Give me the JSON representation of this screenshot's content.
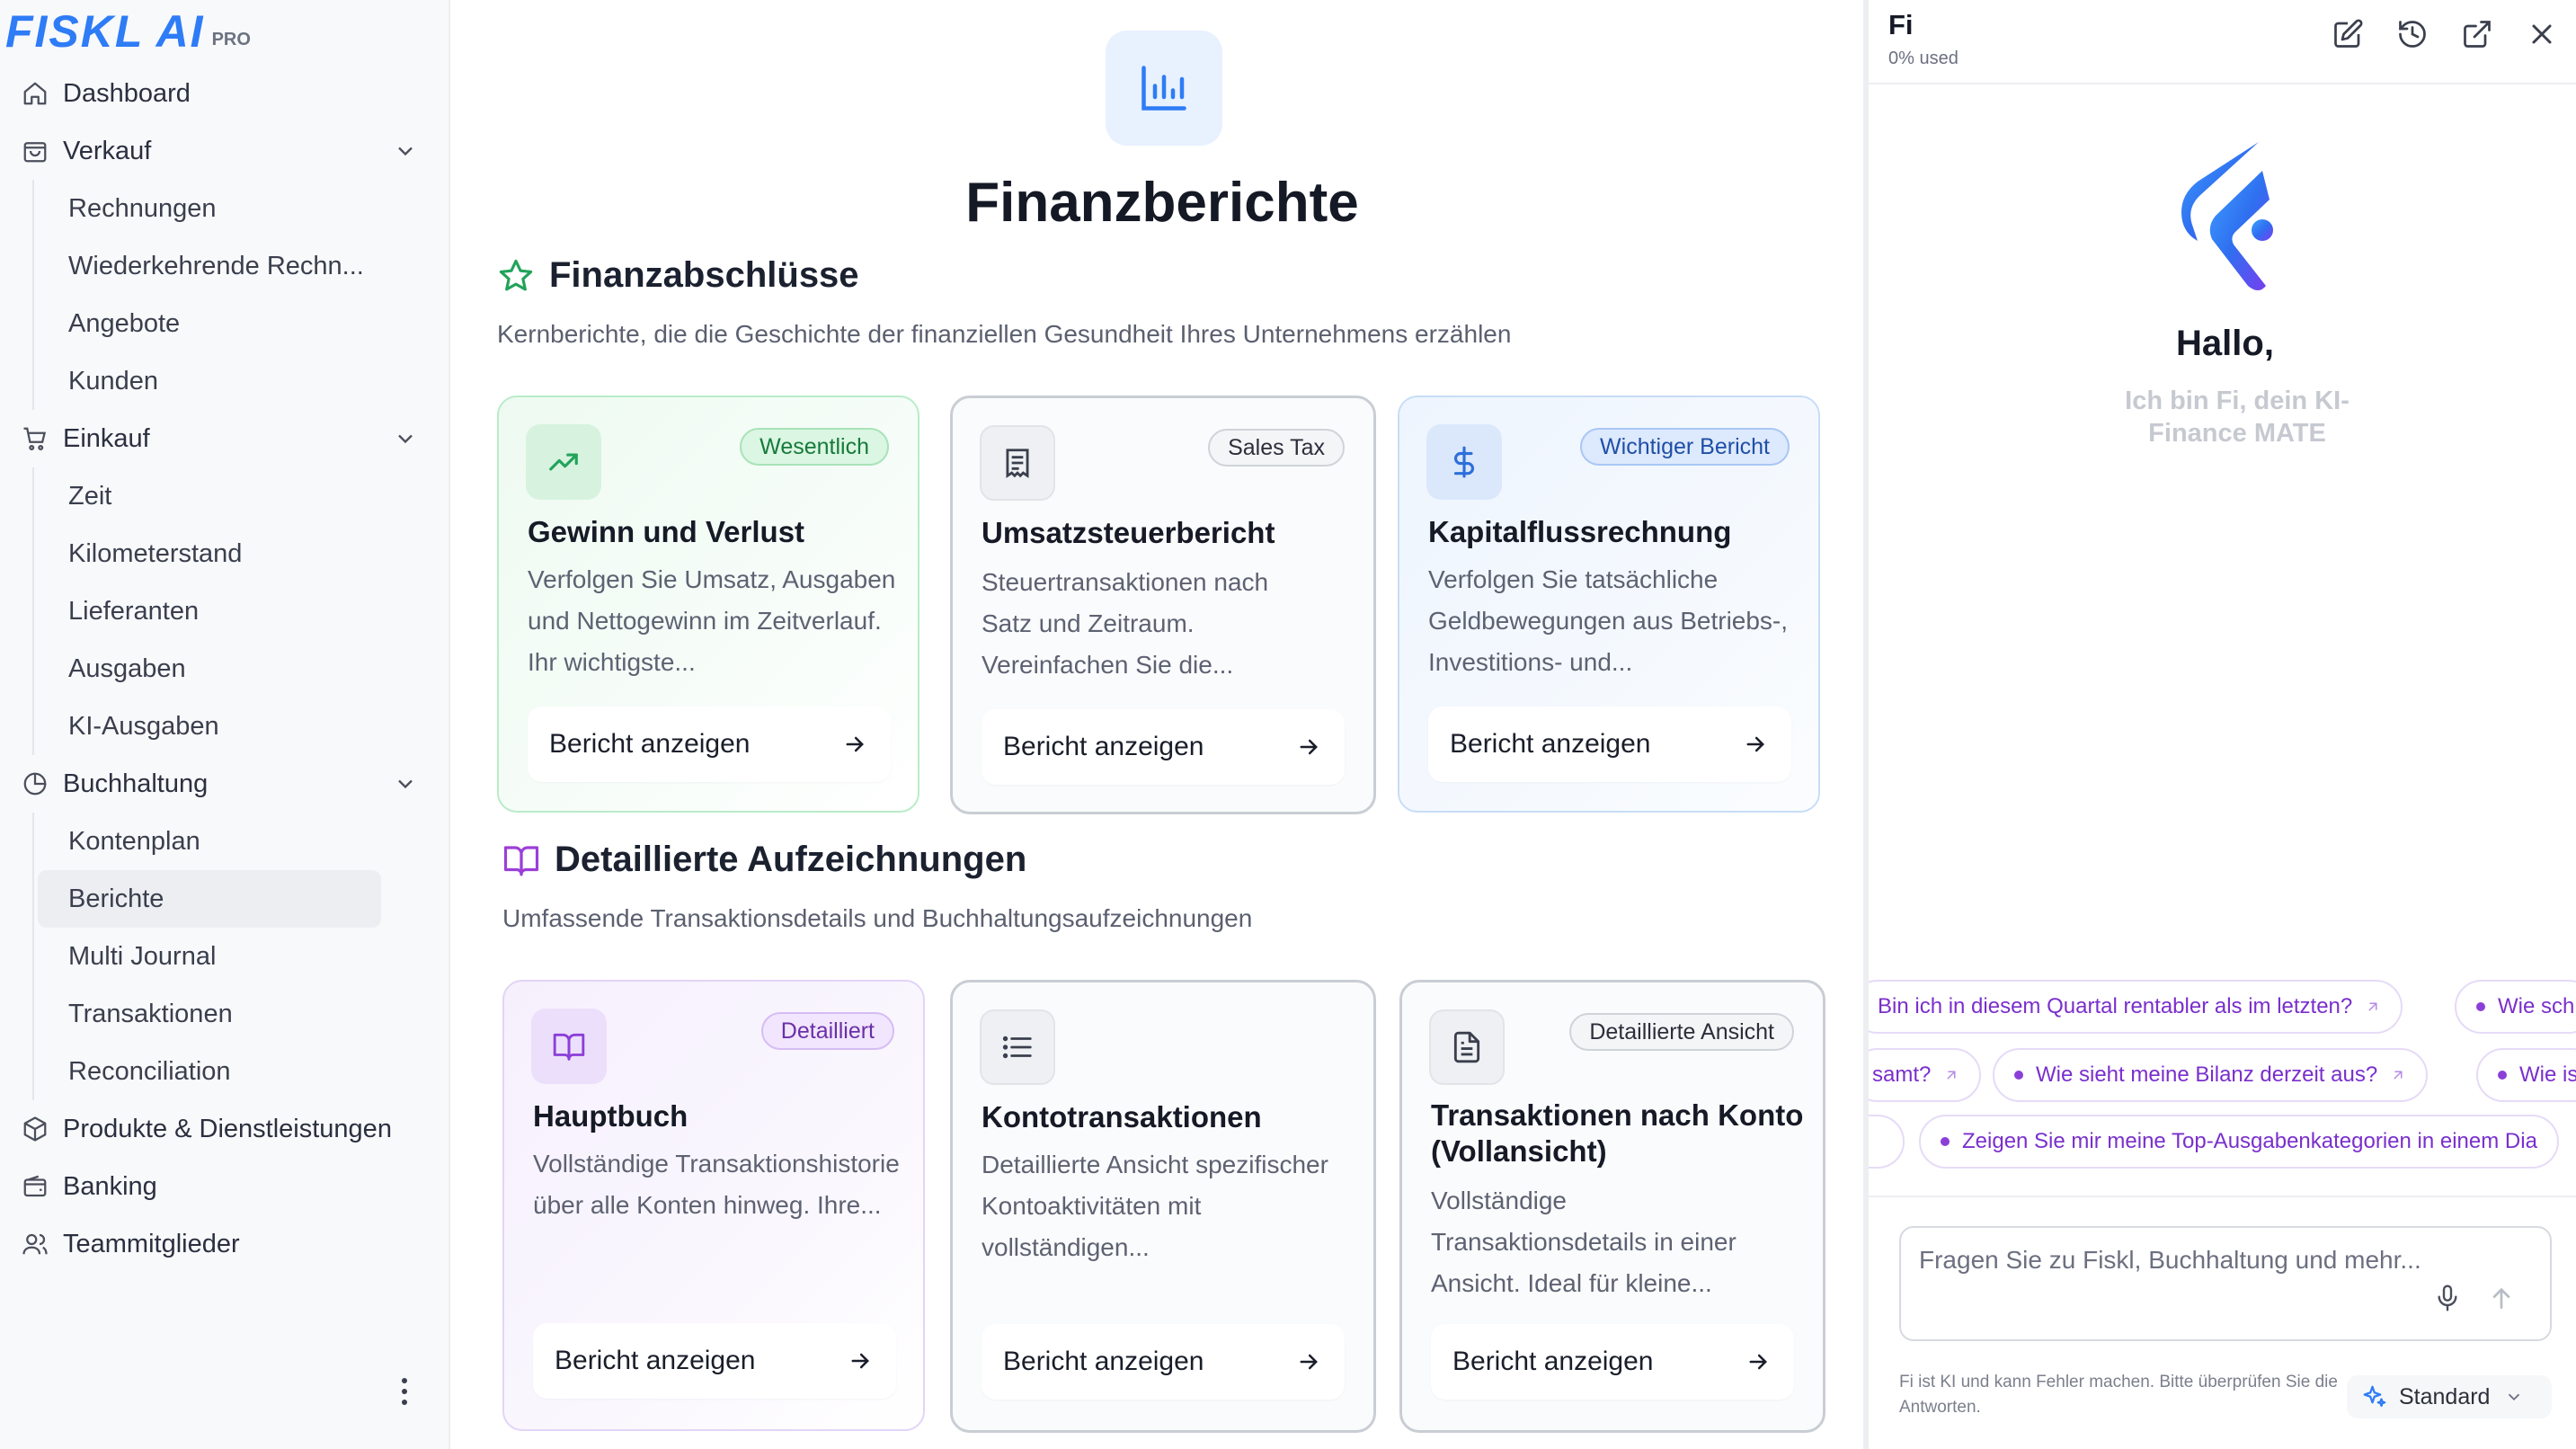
{
  "app": {
    "logo_text": "FISKL AI",
    "logo_badge": "PRO"
  },
  "sidebar": {
    "dashboard": "Dashboard",
    "verkauf": {
      "label": "Verkauf",
      "items": [
        "Rechnungen",
        "Wiederkehrende Rechn...",
        "Angebote",
        "Kunden"
      ]
    },
    "einkauf": {
      "label": "Einkauf",
      "items": [
        "Zeit",
        "Kilometerstand",
        "Lieferanten",
        "Ausgaben",
        "KI-Ausgaben"
      ]
    },
    "buchhaltung": {
      "label": "Buchhaltung",
      "items": [
        "Kontenplan",
        "Berichte",
        "Multi Journal",
        "Transaktionen",
        "Reconciliation"
      ],
      "active": "Berichte"
    },
    "produkte": "Produkte & Dienstleistungen",
    "banking": "Banking",
    "team": "Teammitglieder"
  },
  "main": {
    "title": "Finanzberichte",
    "section1": {
      "title": "Finanzabschlüsse",
      "desc": "Kernberichte, die die Geschichte der finanziellen Gesundheit Ihres Unternehmens erzählen"
    },
    "section2": {
      "title": "Detaillierte Aufzeichnungen",
      "desc": "Umfassende Transaktionsdetails und Buchhaltungsaufzeichnungen"
    },
    "cards": [
      {
        "title": "Gewinn und Verlust",
        "badge": "Wesentlich",
        "desc": "Verfolgen Sie Umsatz, Ausgaben und Nettogewinn im Zeitverlauf. Ihr wichtigste...",
        "button": "Bericht anzeigen"
      },
      {
        "title": "Umsatzsteuerbericht",
        "badge": "Sales Tax",
        "desc": "Steuertransaktionen nach Satz und Zeitraum. Vereinfachen Sie die...",
        "button": "Bericht anzeigen"
      },
      {
        "title": "Kapitalflussrechnung",
        "badge": "Wichtiger Bericht",
        "desc": "Verfolgen Sie tatsächliche Geldbewegungen aus Betriebs-, Investitions- und...",
        "button": "Bericht anzeigen"
      },
      {
        "title": "Hauptbuch",
        "badge": "Detailliert",
        "desc": "Vollständige Transaktionshistorie über alle Konten hinweg. Ihre...",
        "button": "Bericht anzeigen"
      },
      {
        "title": "Kontotransaktionen",
        "badge": "",
        "desc": "Detaillierte Ansicht spezifischer Kontoaktivitäten mit vollständigen...",
        "button": "Bericht anzeigen"
      },
      {
        "title": "Transaktionen nach Konto (Vollansicht)",
        "badge": "Detaillierte Ansicht",
        "desc": "Vollständige Transaktionsdetails in einer Ansicht. Ideal für kleine...",
        "button": "Bericht anzeigen"
      }
    ]
  },
  "chat": {
    "name": "Fi",
    "usage": "0% used",
    "hello": "Hallo,",
    "intro": "Ich bin Fi, dein KI-Finance MATE",
    "suggestions_row1": [
      "Bin ich in diesem Quartal rentabler als im letzten?",
      "Wie sch"
    ],
    "suggestions_row2": [
      "samt?",
      "Wie sieht meine Bilanz derzeit aus?",
      "Wie is"
    ],
    "suggestions_row3": [
      "Zeigen Sie mir meine Top-Ausgabenkategorien in einem Dia"
    ],
    "input_placeholder": "Fragen Sie zu Fiskl, Buchhaltung und mehr...",
    "disclaimer": "Fi ist KI und kann Fehler machen. Bitte überprüfen Sie die Antworten.",
    "mode": "Standard"
  },
  "colors": {
    "brand": "#2e7cf6",
    "accent_purple": "#7a2fcc",
    "green": "#22a35a"
  }
}
